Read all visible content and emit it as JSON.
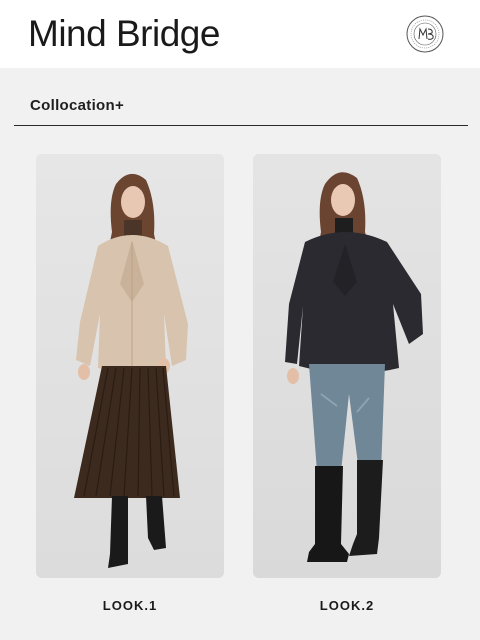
{
  "header": {
    "brand": "Mind Bridge",
    "logo_icon": "mind-bridge-seal-logo",
    "logo_monogram": "MB"
  },
  "section": {
    "title": "Collocation+"
  },
  "looks": [
    {
      "label": "LOOK.1",
      "jacket": "beige wool jacket",
      "bottom": "brown pleated skirt"
    },
    {
      "label": "LOOK.2",
      "jacket": "black wool jacket",
      "bottom": "blue jeans"
    }
  ],
  "colors": {
    "page_bg": "#f1f1f1",
    "header_bg": "#ffffff",
    "card_bg": "#e1e1e1",
    "text": "#1a1a1a"
  }
}
